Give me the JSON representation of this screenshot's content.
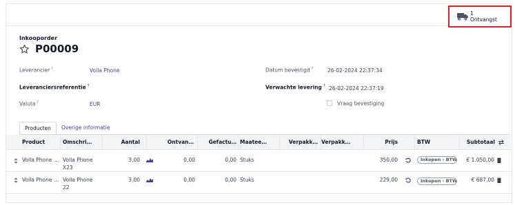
{
  "smart_button": {
    "count": "1",
    "label": "Ontvangst"
  },
  "order": {
    "type_label": "Inkooporder",
    "name": "P00009"
  },
  "fields": {
    "vendor_label": "Leverancier",
    "vendor_value": "Volla Phone",
    "vendor_ref_label": "Leveranciersreferentie",
    "currency_label": "Valuta",
    "currency_value": "EUR",
    "date_approve_label": "Datum bevestigd",
    "date_approve_value": "26-02-2024 22:37:34",
    "date_planned_label": "Verwachte levering",
    "date_planned_value": "26-02-2024 22:37:19",
    "ask_confirm_label": "Vraag bevestiging",
    "help_mark": "?"
  },
  "tabs": [
    {
      "label": "Producten"
    },
    {
      "label": "Overige informatie"
    }
  ],
  "table": {
    "headers": [
      "Product",
      "Omschri…",
      "Aantal",
      "Ontvan…",
      "Gefactu…",
      "Maatee…",
      "Verpakk…",
      "Verpakk…",
      "Prijs",
      "BTW",
      "Subtotaal"
    ],
    "rows": [
      {
        "product": "Volla Phone …",
        "desc1": "Volla Phone",
        "desc2": "X23",
        "qty": "3,00",
        "received": "0,00",
        "invoiced": "0,00",
        "uom": "Stuks",
        "price": "350,00",
        "tax": "Inkopen - BTW 21%",
        "subtotal": "€ 1.050,00"
      },
      {
        "product": "Volla Phone …",
        "desc1": "Volla Phone",
        "desc2": "22",
        "qty": "3,00",
        "received": "0,00",
        "invoiced": "0,00",
        "uom": "Stuks",
        "price": "229,00",
        "tax": "Inkopen - BTW 21%",
        "subtotal": "€ 687,00"
      }
    ]
  },
  "colors": {
    "accent": "#4b3d8f",
    "highlight": "#d9232a"
  }
}
